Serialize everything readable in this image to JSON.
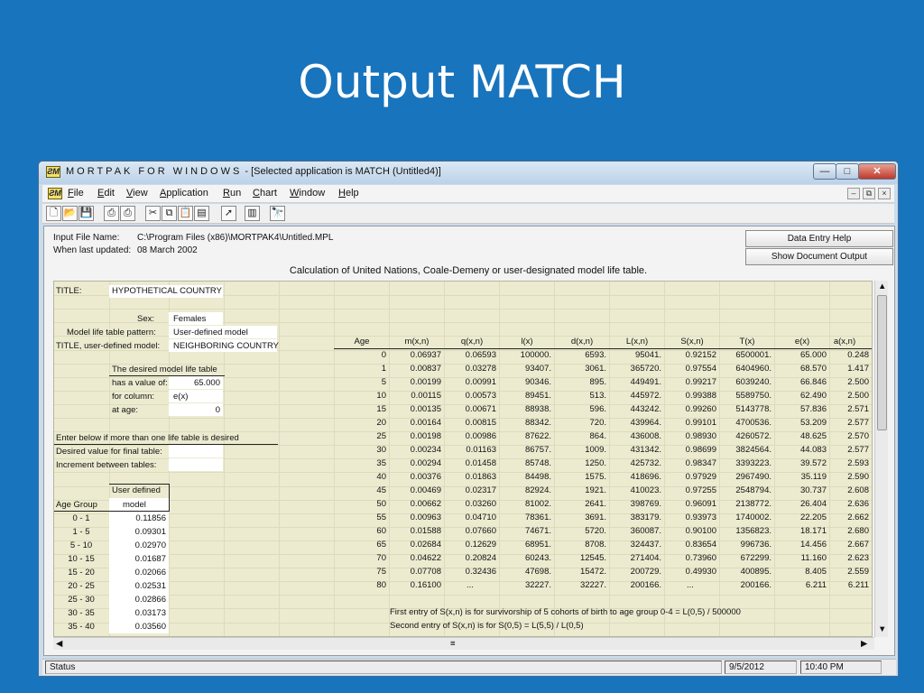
{
  "slide": {
    "title": "Output MATCH"
  },
  "window": {
    "icon": "ƧM",
    "brand": "MORTPAK FOR WINDOWS",
    "title_suffix": " - [Selected application is MATCH  (Untitled4)]",
    "minimize": "—",
    "restore": "□",
    "close": "✕"
  },
  "menu": {
    "icon": "ƧM",
    "items": [
      "File",
      "Edit",
      "View",
      "Application",
      "Run",
      "Chart",
      "Window",
      "Help"
    ],
    "mdi_min": "–",
    "mdi_restore": "⧉",
    "mdi_close": "×"
  },
  "toolbar": {
    "icons": [
      "new-file-icon",
      "open-folder-icon",
      "save-icon",
      "print-icon",
      "print-preview-icon",
      "cut-icon",
      "copy-icon",
      "paste-icon",
      "clipboard-icon",
      "run-icon",
      "chart-icon",
      "find-icon"
    ]
  },
  "header": {
    "input_file_label": "Input File Name:",
    "input_file_value": "C:\\Program Files (x86)\\MORTPAK4\\Untitled.MPL",
    "updated_label": "When last updated:",
    "updated_value": "08 March 2002",
    "btn_help": "Data Entry Help",
    "btn_output": "Show Document Output",
    "calc_title": "Calculation of United Nations, Coale-Demeny or user-designated model life table."
  },
  "form": {
    "title_label": "TITLE:",
    "title_value": "HYPOTHETICAL COUNTRY",
    "sex_label": "Sex:",
    "sex_value": "Females",
    "pattern_label": "Model life table pattern:",
    "pattern_value": "User-defined model",
    "user_title_label": "TITLE, user-defined model:",
    "user_title_value": "NEIGHBORING COUNTRY",
    "desired_heading": "The desired model life table",
    "has_value_label": "has a value of:",
    "has_value": "65.000",
    "column_label": "for column:",
    "column_value": "e(x)",
    "at_age_label": "at age:",
    "at_age_value": "0",
    "multi_heading": "Enter below if more than one life table is desired",
    "final_label": "Desired value for final table:",
    "increment_label": "Increment between tables:",
    "ag_header": "Age Group",
    "ud_header1": "User defined",
    "ud_header2": "model",
    "age_groups": [
      "0 -  1",
      "1 -  5",
      "5 - 10",
      "10 - 15",
      "15 - 20",
      "20 - 25",
      "25 - 30",
      "30 - 35",
      "35 - 40"
    ],
    "ud_values": [
      "0.11856",
      "0.09301",
      "0.02970",
      "0.01687",
      "0.02066",
      "0.02531",
      "0.02866",
      "0.03173",
      "0.03560"
    ]
  },
  "table": {
    "headers": [
      "Age",
      "m(x,n)",
      "q(x,n)",
      "l(x)",
      "d(x,n)",
      "L(x,n)",
      "S(x,n)",
      "T(x)",
      "e(x)",
      "a(x,n)"
    ],
    "rows": [
      [
        "0",
        "0.06937",
        "0.06593",
        "100000.",
        "6593.",
        "95041.",
        "0.92152",
        "6500001.",
        "65.000",
        "0.248"
      ],
      [
        "1",
        "0.00837",
        "0.03278",
        "93407.",
        "3061.",
        "365720.",
        "0.97554",
        "6404960.",
        "68.570",
        "1.417"
      ],
      [
        "5",
        "0.00199",
        "0.00991",
        "90346.",
        "895.",
        "449491.",
        "0.99217",
        "6039240.",
        "66.846",
        "2.500"
      ],
      [
        "10",
        "0.00115",
        "0.00573",
        "89451.",
        "513.",
        "445972.",
        "0.99388",
        "5589750.",
        "62.490",
        "2.500"
      ],
      [
        "15",
        "0.00135",
        "0.00671",
        "88938.",
        "596.",
        "443242.",
        "0.99260",
        "5143778.",
        "57.836",
        "2.571"
      ],
      [
        "20",
        "0.00164",
        "0.00815",
        "88342.",
        "720.",
        "439964.",
        "0.99101",
        "4700536.",
        "53.209",
        "2.577"
      ],
      [
        "25",
        "0.00198",
        "0.00986",
        "87622.",
        "864.",
        "436008.",
        "0.98930",
        "4260572.",
        "48.625",
        "2.570"
      ],
      [
        "30",
        "0.00234",
        "0.01163",
        "86757.",
        "1009.",
        "431342.",
        "0.98699",
        "3824564.",
        "44.083",
        "2.577"
      ],
      [
        "35",
        "0.00294",
        "0.01458",
        "85748.",
        "1250.",
        "425732.",
        "0.98347",
        "3393223.",
        "39.572",
        "2.593"
      ],
      [
        "40",
        "0.00376",
        "0.01863",
        "84498.",
        "1575.",
        "418696.",
        "0.97929",
        "2967490.",
        "35.119",
        "2.590"
      ],
      [
        "45",
        "0.00469",
        "0.02317",
        "82924.",
        "1921.",
        "410023.",
        "0.97255",
        "2548794.",
        "30.737",
        "2.608"
      ],
      [
        "50",
        "0.00662",
        "0.03260",
        "81002.",
        "2641.",
        "398769.",
        "0.96091",
        "2138772.",
        "26.404",
        "2.636"
      ],
      [
        "55",
        "0.00963",
        "0.04710",
        "78361.",
        "3691.",
        "383179.",
        "0.93973",
        "1740002.",
        "22.205",
        "2.662"
      ],
      [
        "60",
        "0.01588",
        "0.07660",
        "74671.",
        "5720.",
        "360087.",
        "0.90100",
        "1356823.",
        "18.171",
        "2.680"
      ],
      [
        "65",
        "0.02684",
        "0.12629",
        "68951.",
        "8708.",
        "324437.",
        "0.83654",
        "996736.",
        "14.456",
        "2.667"
      ],
      [
        "70",
        "0.04622",
        "0.20824",
        "60243.",
        "12545.",
        "271404.",
        "0.73960",
        "672299.",
        "11.160",
        "2.623"
      ],
      [
        "75",
        "0.07708",
        "0.32436",
        "47698.",
        "15472.",
        "200729.",
        "0.49930",
        "400895.",
        "8.405",
        "2.559"
      ],
      [
        "80",
        "0.16100",
        "...",
        "32227.",
        "32227.",
        "200166.",
        "...",
        "200166.",
        "6.211",
        "6.211"
      ]
    ],
    "note1": "First entry of S(x,n) is for survivorship of 5 cohorts of birth to age group 0-4 = L(0,5) / 500000",
    "note2": "Second entry of S(x,n) is for S(0,5) = L(5,5) / L(0,5)"
  },
  "status": {
    "label": "Status",
    "date": "9/5/2012",
    "time": "10:40 PM"
  }
}
